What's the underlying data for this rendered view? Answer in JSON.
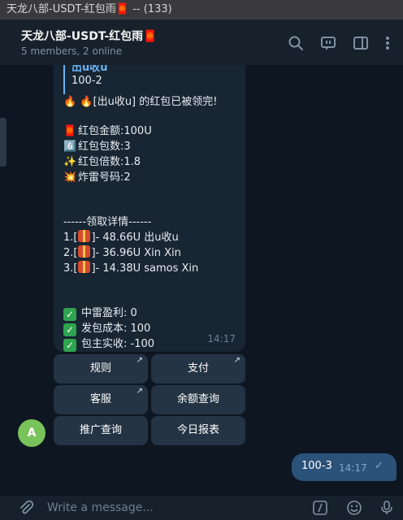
{
  "window": {
    "title": "天龙八部-USDT-红包雨🧧 -- (133)"
  },
  "header": {
    "chat_title": "天龙八部-USDT-红包雨🧧",
    "subtitle": "5 members, 2 online"
  },
  "message": {
    "reply_name": "出u收u",
    "reply_text": "100-2",
    "claimed_text": "🔥 🔥[出u收u] 的红包已被领完!",
    "amount": "红包金额:100U",
    "count": "红包包数:3",
    "multiplier": "红包倍数:1.8",
    "mine_number": "炸雷号码:2",
    "details_title": "------领取详情------",
    "claims": [
      {
        "prefix": "1.[",
        "text": "]- 48.66U   出u收u"
      },
      {
        "prefix": "2.[",
        "text": "]- 36.96U   Xin Xin"
      },
      {
        "prefix": "3.[",
        "text": "]- 14.38U   samos Xin"
      }
    ],
    "mine_profit": "中雷盈利:  0",
    "issue_cost": "发包成本:  100",
    "owner_net": "包主实收:  -100",
    "time": "14:17"
  },
  "keyboard": {
    "rules": "规则",
    "pay": "支付",
    "support": "客服",
    "balance": "余额查询",
    "promo": "推广查询",
    "report": "今日报表"
  },
  "avatar": {
    "letter": "A",
    "color": "#78c35a"
  },
  "outgoing": {
    "text": "100-3",
    "time": "14:17"
  },
  "composer": {
    "placeholder": "Write a message..."
  },
  "colors": {
    "background": "#0e1621",
    "bubble": "#182533",
    "outgoing_bubble": "#2b5278",
    "accent": "#6ab2f2"
  }
}
